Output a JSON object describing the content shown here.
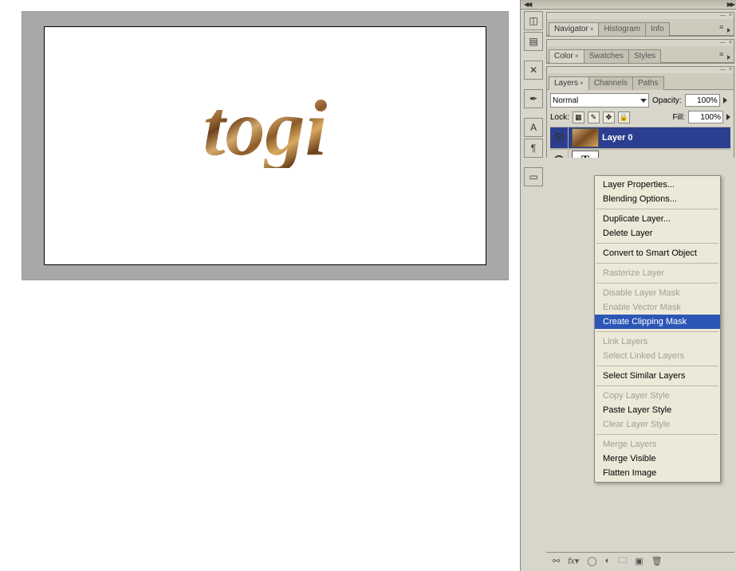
{
  "canvas_text": "togi",
  "dock_arrows": "◀◀",
  "dock_arrows_r": "▶▶",
  "panels": {
    "nav": {
      "tabs": [
        "Navigator",
        "Histogram",
        "Info"
      ],
      "active": 0
    },
    "color": {
      "tabs": [
        "Color",
        "Swatches",
        "Styles"
      ],
      "active": 0
    },
    "layers": {
      "tabs": [
        "Layers",
        "Channels",
        "Paths"
      ],
      "active": 0
    }
  },
  "vstrip_icons": [
    "navigator-icon",
    "brush-icon",
    "",
    "tools-icon",
    "",
    "pen-icon",
    "",
    "char-a-icon",
    "para-icon",
    "",
    "doc-icon"
  ],
  "layers": {
    "blend_label": "Normal",
    "opacity_label": "Opacity:",
    "opacity_value": "100%",
    "lock_label": "Lock:",
    "fill_label": "Fill:",
    "fill_value": "100%",
    "items": [
      {
        "name": "Layer 0",
        "type": "img",
        "selected": true,
        "visible": true
      },
      {
        "name": "",
        "type": "t",
        "selected": false,
        "visible": true
      },
      {
        "name": "",
        "type": "blank",
        "selected": false,
        "visible": true
      },
      {
        "name": "",
        "type": "blank",
        "selected": false,
        "visible": true
      }
    ]
  },
  "context_menu": [
    {
      "label": "Layer Properties...",
      "enabled": true
    },
    {
      "label": "Blending Options...",
      "enabled": true
    },
    {
      "sep": true
    },
    {
      "label": "Duplicate Layer...",
      "enabled": true
    },
    {
      "label": "Delete Layer",
      "enabled": true
    },
    {
      "sep": true
    },
    {
      "label": "Convert to Smart Object",
      "enabled": true
    },
    {
      "sep": true
    },
    {
      "label": "Rasterize Layer",
      "enabled": false
    },
    {
      "sep": true
    },
    {
      "label": "Disable Layer Mask",
      "enabled": false
    },
    {
      "label": "Enable Vector Mask",
      "enabled": false
    },
    {
      "label": "Create Clipping Mask",
      "enabled": true,
      "selected": true
    },
    {
      "sep": true
    },
    {
      "label": "Link Layers",
      "enabled": false
    },
    {
      "label": "Select Linked Layers",
      "enabled": false
    },
    {
      "sep": true
    },
    {
      "label": "Select Similar Layers",
      "enabled": true
    },
    {
      "sep": true
    },
    {
      "label": "Copy Layer Style",
      "enabled": false
    },
    {
      "label": "Paste Layer Style",
      "enabled": true
    },
    {
      "label": "Clear Layer Style",
      "enabled": false
    },
    {
      "sep": true
    },
    {
      "label": "Merge Layers",
      "enabled": false
    },
    {
      "label": "Merge Visible",
      "enabled": true
    },
    {
      "label": "Flatten Image",
      "enabled": true
    }
  ],
  "footer_icons": [
    "link-icon",
    "fx-icon",
    "mask-icon",
    "adjust-icon",
    "folder-icon",
    "new-icon",
    "trash-icon"
  ]
}
